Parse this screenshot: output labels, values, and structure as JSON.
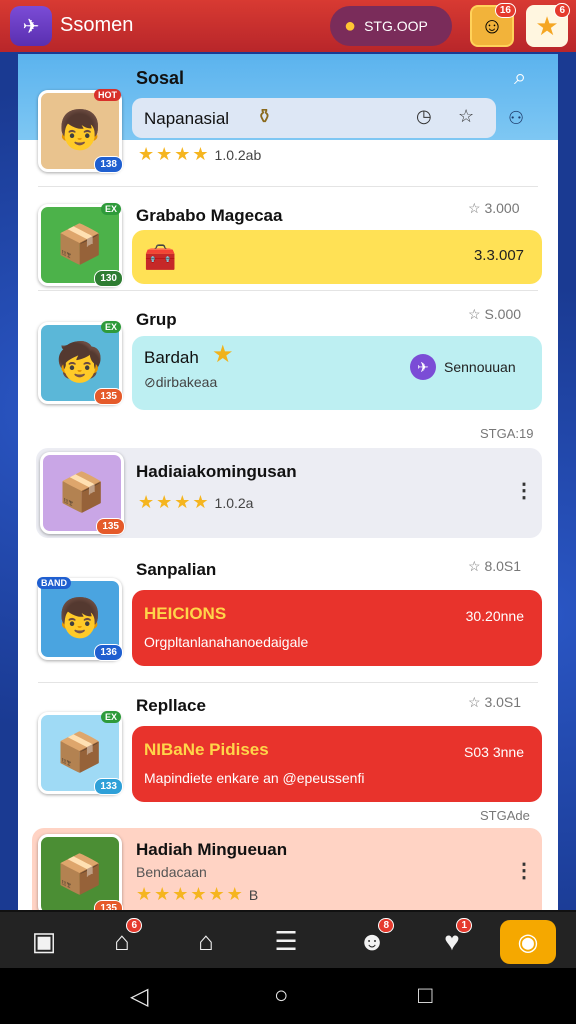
{
  "topbar": {
    "app_title": "Ssomen",
    "coins": "STG.OOP",
    "avatar_badge": "16",
    "star_badge": "6",
    "icons": [
      "paper-plane-icon",
      "coin-person-icon",
      "avatar-icon",
      "star-icon"
    ]
  },
  "header": {
    "title": "Sosal",
    "search_value": "Napanasial",
    "row_rating": "1.0.2ab",
    "thumb_level": "138"
  },
  "items": [
    {
      "title": "Grababo Magecaa",
      "score": "3.000",
      "price": "3.3.007",
      "thumb_level": "130",
      "thumb_top": "EX"
    },
    {
      "title": "Grup",
      "score": "S.000",
      "card_title": "Bardah",
      "card_sub": "dirbakeaa",
      "card_action": "Sennouuan",
      "thumb_level": "135",
      "thumb_top": "EX",
      "footer_tag": "STGA:19"
    },
    {
      "title": "Hadiaiakomingusan",
      "rating": "1.0.2a",
      "thumb_level": "135"
    },
    {
      "title": "Sanpalian",
      "score": "8.0S1",
      "card_title": "HEICIONS",
      "card_sub": "Orgpltanlanahanoedaigale",
      "card_price": "30.20nne",
      "thumb_level": "136",
      "thumb_top": "BAND"
    },
    {
      "title": "Repllace",
      "score": "3.0S1",
      "card_title": "NIBaNe Pidises",
      "card_sub": "Mapindiete enkare an @epeussenfi",
      "card_price": "S03 3nne",
      "thumb_level": "133",
      "footer_tag": "STGAde"
    },
    {
      "title": "Hadiah Mingueuan",
      "subtitle": "Bendacaan",
      "rating": "B",
      "thumb_level": "135"
    }
  ],
  "bottomnav": {
    "badges": [
      "6",
      "8",
      "1"
    ]
  },
  "colors": {
    "topbar": "#c8302e",
    "header": "#6dbdf0",
    "yellow_card": "#ffe155",
    "cyan_card": "#bdeff2",
    "red_card": "#e8332c",
    "peach_card": "#ffd3c4",
    "nav_active": "#f5a800"
  }
}
